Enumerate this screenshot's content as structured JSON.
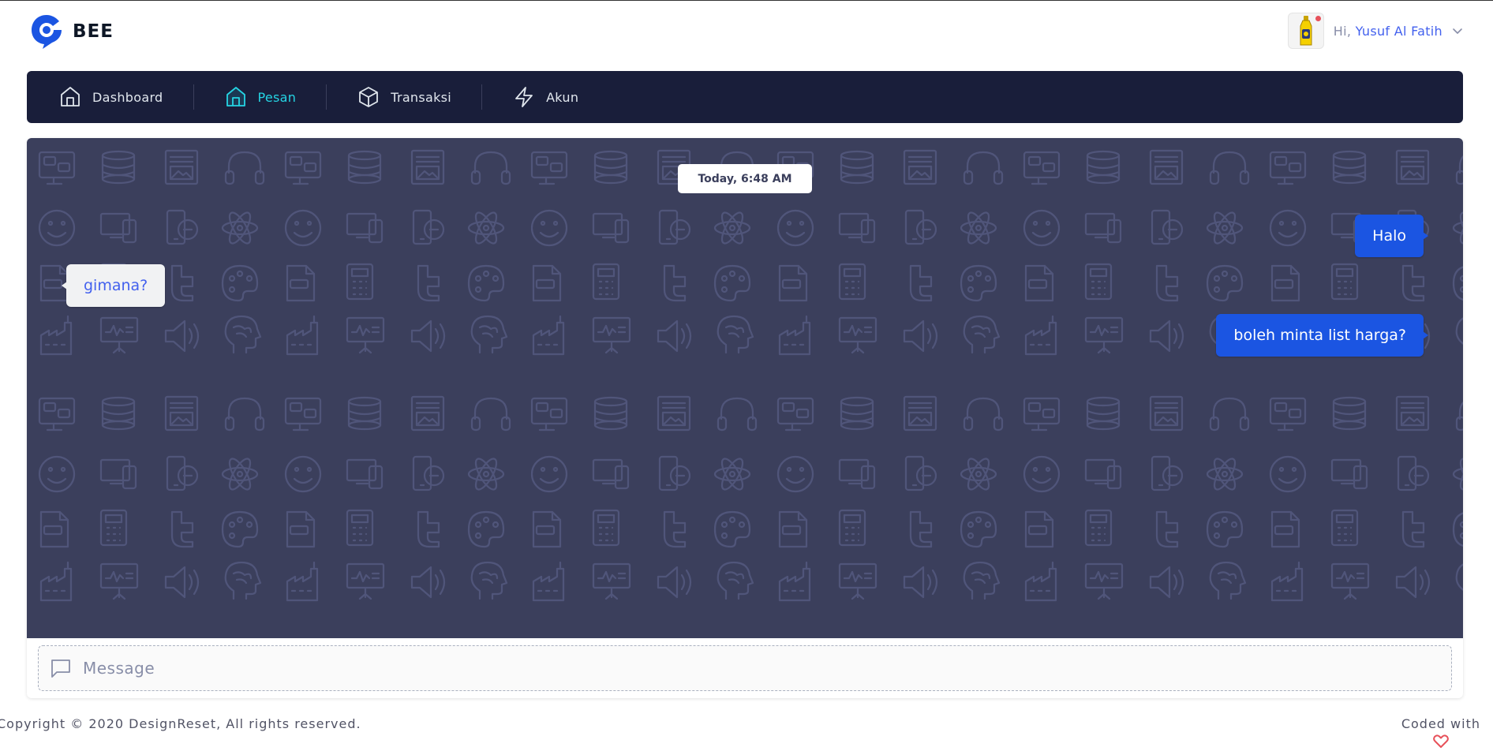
{
  "app": {
    "name": "BEE"
  },
  "user": {
    "greeting_prefix": "Hi, ",
    "name": "Yusuf Al Fatih"
  },
  "nav": {
    "items": [
      {
        "label": "Dashboard",
        "icon": "home-icon",
        "active": false
      },
      {
        "label": "Pesan",
        "icon": "home-icon",
        "active": true
      },
      {
        "label": "Transaksi",
        "icon": "box-icon",
        "active": false
      },
      {
        "label": "Akun",
        "icon": "zap-icon",
        "active": false
      }
    ]
  },
  "chat": {
    "timestamp": "Today, 6:48 AM",
    "messages": [
      {
        "from": "me",
        "text": "Halo"
      },
      {
        "from": "you",
        "text": "gimana?"
      },
      {
        "from": "me",
        "text": "boleh minta list harga?"
      }
    ],
    "input_placeholder": "Message",
    "input_value": ""
  },
  "footer": {
    "copyright": "Copyright © 2020 DesignReset, All rights reserved.",
    "coded_with": "Coded with"
  },
  "colors": {
    "nav_bg": "#191e3a",
    "nav_active": "#25d5e4",
    "chat_bg": "#3b3f5c",
    "bubble_me": "#1b55e2",
    "bubble_you": "#f1f2f3",
    "accent": "#4361ee",
    "heart": "#e7515a"
  }
}
